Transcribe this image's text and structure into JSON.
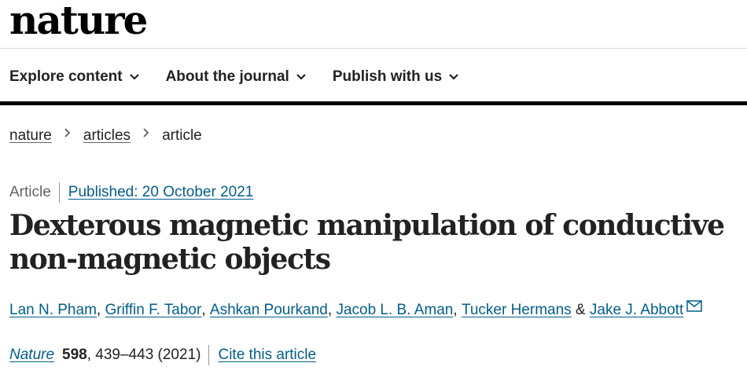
{
  "header": {
    "logo_text": "nature",
    "nav": [
      {
        "label": "Explore content"
      },
      {
        "label": "About the journal"
      },
      {
        "label": "Publish with us"
      }
    ]
  },
  "breadcrumb": {
    "items": [
      "nature",
      "articles"
    ],
    "current": "article"
  },
  "article": {
    "type": "Article",
    "published": "Published: 20 October 2021",
    "title": "Dexterous magnetic manipulation of conductive non-magnetic objects",
    "authors": [
      "Lan N. Pham",
      "Griffin F. Tabor",
      "Ashkan Pourkand",
      "Jacob L. B. Aman",
      "Tucker Hermans",
      "Jake J. Abbott"
    ],
    "author_separators": [
      ", ",
      ", ",
      ", ",
      ", ",
      " & "
    ],
    "citation": {
      "journal": "Nature",
      "volume": "598",
      "pages": ", 439–443 (2021)",
      "cite_label": "Cite this article"
    }
  },
  "colors": {
    "link": "#025e8d",
    "text": "#222222",
    "muted": "#626262",
    "rule": "#000000"
  }
}
